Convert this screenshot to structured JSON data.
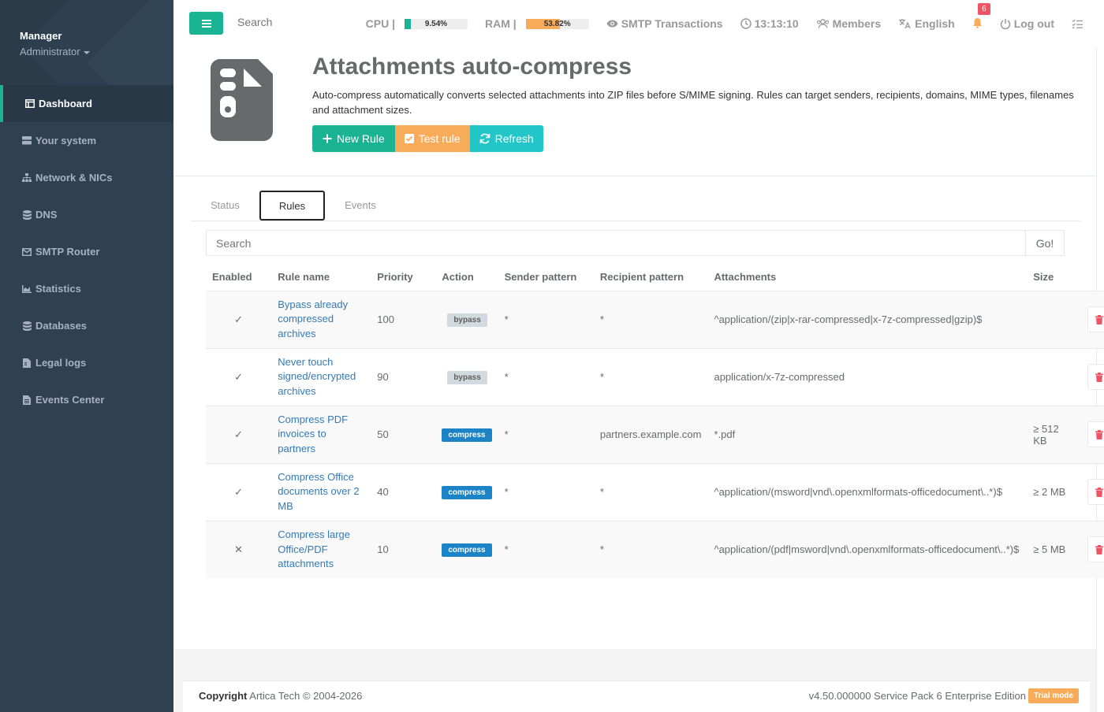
{
  "sidebar": {
    "profile_name": "Manager",
    "profile_role": "Administrator",
    "items": [
      {
        "label": "Dashboard",
        "icon": "table-icon"
      },
      {
        "label": "Your system",
        "icon": "server-icon"
      },
      {
        "label": "Network & NICs",
        "icon": "network-icon"
      },
      {
        "label": "DNS",
        "icon": "database-icon"
      },
      {
        "label": "SMTP Router",
        "icon": "envelope-icon"
      },
      {
        "label": "Statistics",
        "icon": "chart-icon"
      },
      {
        "label": "Databases",
        "icon": "database-icon"
      },
      {
        "label": "Legal logs",
        "icon": "file-icon"
      },
      {
        "label": "Events Center",
        "icon": "file-text-icon"
      }
    ]
  },
  "topbar": {
    "search_placeholder": "Search",
    "cpu_label": "CPU |",
    "cpu_value": "9.54%",
    "cpu_fraction": 0.0954,
    "cpu_color": "#1ab394",
    "ram_label": "RAM |",
    "ram_value": "53.82%",
    "ram_fraction": 0.5382,
    "ram_color": "#f8ac59",
    "smtp_label": "SMTP Transactions",
    "clock": "13:13:10",
    "members_label": "Members",
    "language_label": "English",
    "notifications_count": "6",
    "logout_label": "Log out"
  },
  "header": {
    "title": "Attachments auto-compress",
    "description": "Auto-compress automatically converts selected attachments into ZIP files before S/MIME signing. Rules can target senders, recipients, domains, MIME types, filenames and attachment sizes.",
    "new_rule_label": "New Rule",
    "test_rule_label": "Test rule",
    "refresh_label": "Refresh"
  },
  "tabs": [
    {
      "label": "Status"
    },
    {
      "label": "Rules"
    },
    {
      "label": "Events"
    }
  ],
  "search": {
    "placeholder": "Search",
    "go_label": "Go!"
  },
  "table": {
    "headers": {
      "enabled": "Enabled",
      "name": "Rule name",
      "priority": "Priority",
      "action": "Action",
      "sender": "Sender pattern",
      "recipient": "Recipient pattern",
      "attachments": "Attachments",
      "size": "Size"
    },
    "rows": [
      {
        "enabled": "✓",
        "name": "Bypass already compressed archives",
        "priority": "100",
        "action": "bypass",
        "sender": "*",
        "recipient": "*",
        "attachments": "^application/(zip|x-rar-compressed|x-7z-compressed|gzip)$",
        "size": ""
      },
      {
        "enabled": "✓",
        "name": "Never touch signed/encrypted archives",
        "priority": "90",
        "action": "bypass",
        "sender": "*",
        "recipient": "*",
        "attachments": "application/x-7z-compressed",
        "size": ""
      },
      {
        "enabled": "✓",
        "name": "Compress PDF invoices to partners",
        "priority": "50",
        "action": "compress",
        "sender": "*",
        "recipient": "partners.example.com",
        "attachments": "*.pdf",
        "size": "≥ 512 KB"
      },
      {
        "enabled": "✓",
        "name": "Compress Office documents over 2 MB",
        "priority": "40",
        "action": "compress",
        "sender": "*",
        "recipient": "*",
        "attachments": "^application/(msword|vnd\\.openxmlformats-officedocument\\..*)$",
        "size": "≥ 2 MB"
      },
      {
        "enabled": "✕",
        "name": "Compress large Office/PDF attachments",
        "priority": "10",
        "action": "compress",
        "sender": "*",
        "recipient": "*",
        "attachments": "^application/(pdf|msword|vnd\\.openxmlformats-officedocument\\..*)$",
        "size": "≥ 5 MB"
      }
    ]
  },
  "footer": {
    "copyright_bold": "Copyright",
    "copyright_text": "Artica Tech © 2004-2026",
    "version": "v4.50.000000 Service Pack 6 Enterprise Edition",
    "trial_label": "Trial mode"
  }
}
